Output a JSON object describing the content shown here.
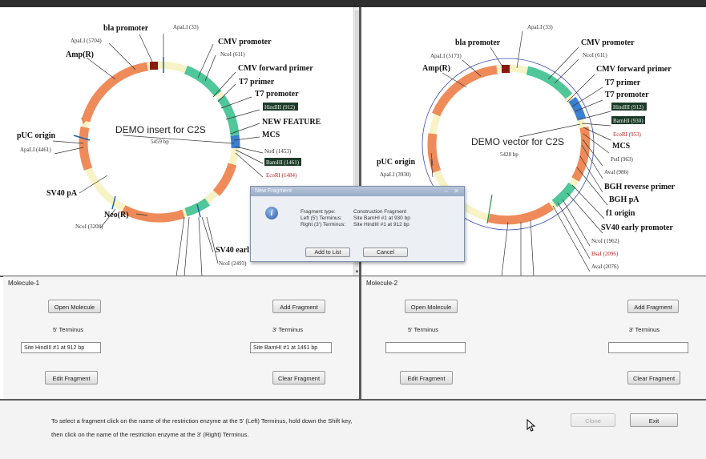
{
  "colors": {
    "feature_orange": "#ef8a5a",
    "feature_green": "#4fc79a",
    "feature_pale": "#f7f3c6",
    "highlight_label_bg": "#1e3b2a",
    "restriction_red": "#c02020"
  },
  "left_map": {
    "title": "DEMO insert for C2S",
    "size": "5459 bp",
    "labels": {
      "bla_promoter": "bla promoter",
      "apali_33": "ApaLI (33)",
      "apali_5704": "ApaLI (5704)",
      "amp": "Amp(R)",
      "cmv_promoter": "CMV promoter",
      "ncoi_611": "NcoI (611)",
      "cmv_fwd": "CMV forward primer",
      "t7_primer": "T7 primer",
      "t7_promoter": "T7 promoter",
      "hindiii_912": "HindIII (912)",
      "new_feature": "NEW FEATURE",
      "mcs": "MCS",
      "noti_1453": "NotI (1453)",
      "bamhi_1461": "BamHI (1461)",
      "ecori_1484": "EcoRI (1484)",
      "puc_origin": "pUC origin",
      "apali_4461": "ApaLI (4461)",
      "sv40_pa": "SV40 pA",
      "ncoi_3208": "NcoI (3208)",
      "neo": "Neo(R)",
      "sv40_early": "SV40 earl",
      "ncoi_2493": "NcoI (2493)"
    }
  },
  "right_map": {
    "title": "DEMO vector for C2S",
    "size": "5428 bp",
    "labels": {
      "apali_33": "ApaLI (33)",
      "bla_promoter": "bla promoter",
      "apali_5173": "ApaLI (5173)",
      "amp": "Amp(R)",
      "cmv_promoter": "CMV promoter",
      "ncoi_611": "NcoI (611)",
      "cmv_fwd": "CMV forward primer",
      "t7_primer": "T7 primer",
      "t7_promoter": "T7 promoter",
      "hindiii_912": "HindIII (912)",
      "bamhi_930": "BamHI (930)",
      "ecori_953": "EcoRI (953)",
      "mcs": "MCS",
      "psti_963": "PstI (963)",
      "avai_986": "AvaI (986)",
      "bgh_rev": "BGH reverse primer",
      "bgh_pa": "BGH pA",
      "f1_origin": "f1 origin",
      "sv40_early": "SV40 early promoter",
      "ncoi_1962": "NcoI (1962)",
      "bsai_2096": "BsaI (2096)",
      "avai_2076": "AvaI (2076)",
      "puc_origin": "pUC origin",
      "apali_3930": "ApaLI (3930)"
    }
  },
  "dialog": {
    "title": "New Fragment",
    "rows": [
      {
        "label": "Fragment type:",
        "value": "Construction Fragment"
      },
      {
        "label": "Left (5') Terminus:",
        "value": "Site BamHI #1 at 930 bp"
      },
      {
        "label": "Right (3') Terminus:",
        "value": "Site HindIII #1 at 912 bp"
      }
    ],
    "ok_label": "Add to List",
    "cancel_label": "Cancel"
  },
  "molecule1": {
    "title": "Molecule-1",
    "open_label": "Open Molecule",
    "add_label": "Add Fragment",
    "five_label": "5' Terminus",
    "three_label": "3' Terminus",
    "five_value": "Site HindIII #1 at 912 bp",
    "three_value": "Site BamHI #1 at 1461 bp",
    "edit_label": "Edit Fragment",
    "clear_label": "Clear Fragment"
  },
  "molecule2": {
    "title": "Molecule-2",
    "open_label": "Open Molecule",
    "add_label": "Add Fragment",
    "five_label": "5' Terminus",
    "three_label": "3' Terminus",
    "five_value": "",
    "three_value": "",
    "edit_label": "Edit Fragment",
    "clear_label": "Clear Fragment"
  },
  "bottom": {
    "instruction_line1": "To select a fragment click on the name of the restriction enzyme at the 5' (Left) Terminus,  hold down the Shift key,",
    "instruction_line2": "then click on the name of the restriction enzyme at the 3' (Right) Terminus.",
    "clone_label": "Clone",
    "exit_label": "Exit"
  }
}
